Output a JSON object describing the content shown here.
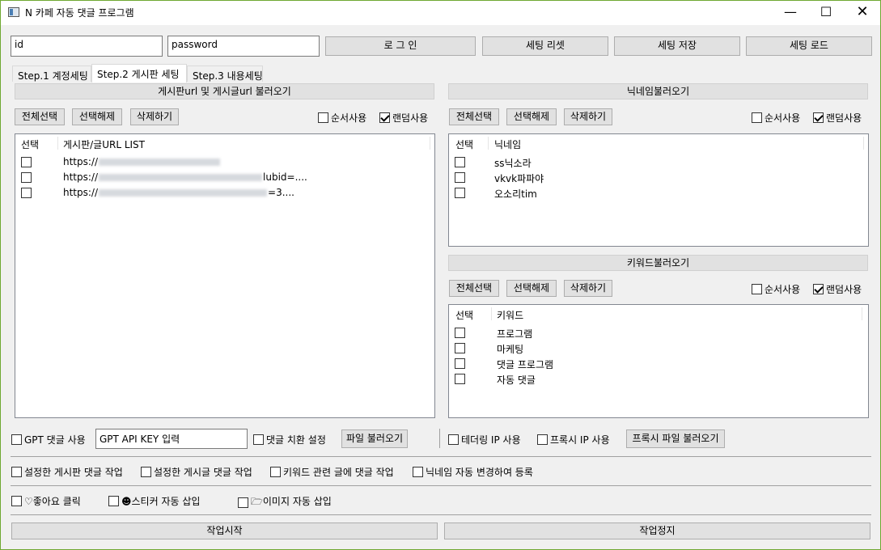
{
  "window": {
    "title": "N 카페 자동 댓글 프로그램",
    "minimize": "—",
    "maximize": "☐",
    "close": "✕"
  },
  "login": {
    "id_value": "id",
    "password_value": "password",
    "login_btn": "로 그 인",
    "reset_btn": "세팅 리셋",
    "save_btn": "세팅 저장",
    "load_btn": "세팅 로드"
  },
  "tabs": [
    "Step.1 계정세팅",
    "Step.2 게시판 세팅",
    "Step.3 내용세팅"
  ],
  "board": {
    "header": "게시판url 및 게시글url 불러오기",
    "select_all": "전체선택",
    "deselect": "선택해제",
    "delete": "삭제하기",
    "seq": "순서사용",
    "seq_checked": false,
    "random": "랜덤사용",
    "random_checked": true,
    "col_select": "선택",
    "col_url": "게시판/글URL LIST",
    "rows": [
      {
        "prefix": "https://",
        "suffix": "",
        "checked": false
      },
      {
        "prefix": "https://",
        "suffix": "lubid=....",
        "checked": false
      },
      {
        "prefix": "https://",
        "suffix": "=3....",
        "checked": false
      }
    ]
  },
  "nickname": {
    "header": "닉네임불러오기",
    "select_all": "전체선택",
    "deselect": "선택해제",
    "delete": "삭제하기",
    "seq": "순서사용",
    "seq_checked": false,
    "random": "랜덤사용",
    "random_checked": true,
    "col_select": "선택",
    "col_name": "닉네임",
    "rows": [
      "ss닉소라",
      "vkvk파파야",
      "오소리tim"
    ]
  },
  "keyword": {
    "header": "키워드불러오기",
    "select_all": "전체선택",
    "deselect": "선택해제",
    "delete": "삭제하기",
    "seq": "순서사용",
    "seq_checked": false,
    "random": "랜덤사용",
    "random_checked": true,
    "col_select": "선택",
    "col_name": "키워드",
    "rows": [
      "프로그램",
      "마케팅",
      "댓글 프로그램",
      "자동 댓글"
    ]
  },
  "options": {
    "gpt_comment": "GPT 댓글 사용",
    "gpt_key_value": "GPT API KEY 입력",
    "comment_replace": "댓글 치환 설정",
    "load_file": "파일 불러오기",
    "tethering_ip": "테더링 IP 사용",
    "proxy_ip": "프록시 IP 사용",
    "load_proxy_file": "프록시 파일 불러오기",
    "board_comment": "설정한 게시판 댓글 작업",
    "post_comment": "설정한 게시글 댓글 작업",
    "keyword_comment": "키워드 관련 글에 댓글 작업",
    "nickname_change": "닉네임 자동 변경하여 등록",
    "like_click": "♡좋아요 클릭",
    "sticker_insert": "☻스티커 자동 삽입",
    "image_insert": "🗁이미지 자동 삽입"
  },
  "actions": {
    "start": "작업시작",
    "stop": "작업정지"
  }
}
